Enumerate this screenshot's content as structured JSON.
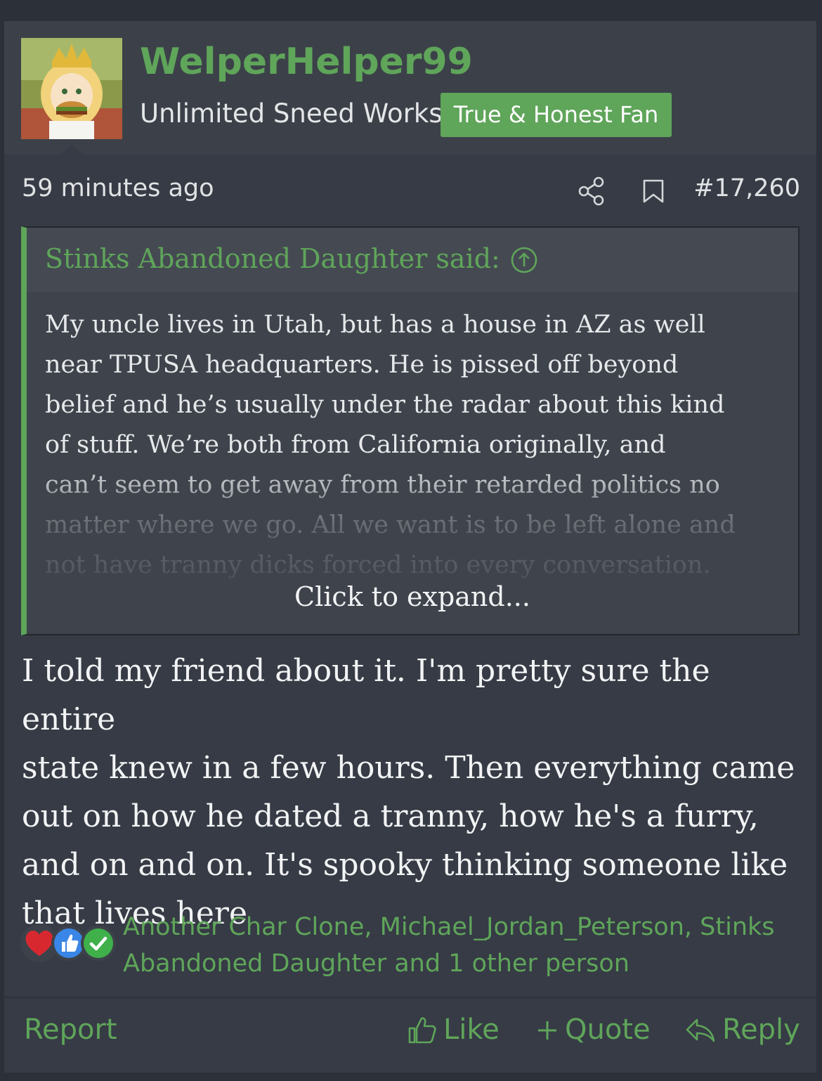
{
  "post": {
    "username": "WelperHelper99",
    "user_title": "Unlimited Sneed Works",
    "user_banner": "True & Honest Fan",
    "timestamp": "59 minutes ago",
    "post_number": "#17,260",
    "quote": {
      "author_line": "Stinks Abandoned Daughter said:",
      "lines": [
        "My uncle lives in Utah, but has a house in AZ as well",
        "near TPUSA headquarters. He is pissed off beyond",
        "belief and he’s usually under the radar about this kind",
        "of stuff. We’re both from California originally, and",
        "can’t seem to get away from their retarded politics no",
        "matter where we go. All we want is to be left alone and",
        "not have tranny dicks forced into every conversation."
      ],
      "expand_label": "Click to expand..."
    },
    "body_lines": [
      "I told my friend about it. I'm pretty sure the entire",
      "state knew in a few hours. Then everything came",
      "out on how he dated a tranny, how he's a furry,",
      "and on and on. It's spooky thinking someone like",
      "that lives here"
    ],
    "reactions": {
      "icons": [
        "heart-icon",
        "thumbs-up-icon",
        "check-icon"
      ],
      "users_line_1": "Another Char Clone, Michael_Jordan_Peterson, Stinks",
      "users_line_2": "Abandoned Daughter and 1 other person"
    },
    "actions": {
      "report": "Report",
      "like": "Like",
      "quote": "Quote",
      "reply": "Reply"
    }
  },
  "colors": {
    "accent": "#5fa55a",
    "background": "#363b45",
    "header_background": "#3c4149",
    "quote_background": "#3f444c",
    "text": "#f2f3f4"
  }
}
